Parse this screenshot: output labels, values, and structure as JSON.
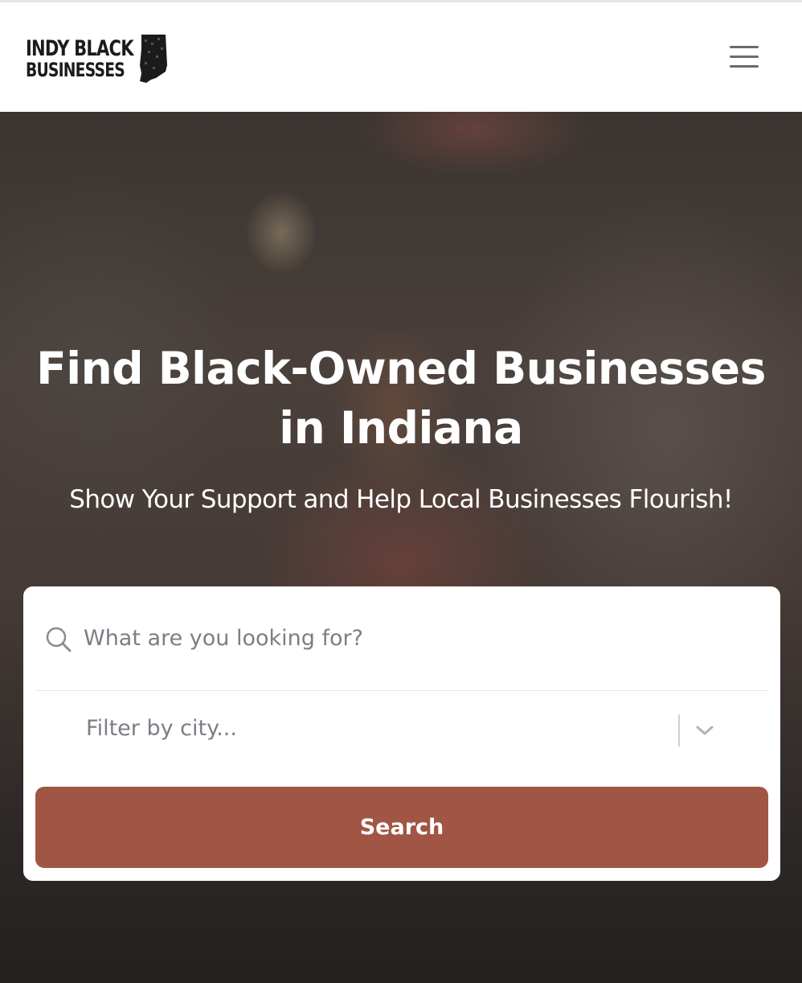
{
  "header": {
    "logo_line1": "INDY BLACK",
    "logo_line2": "BUSINESSES",
    "menu_icon": "hamburger-menu-icon"
  },
  "hero": {
    "title": "Find Black-Owned Businesses in Indiana",
    "subtitle": "Show Your Support and Help Local Businesses Flourish!"
  },
  "search": {
    "icon": "search-icon",
    "placeholder": "What are you looking for?",
    "city_placeholder": "Filter by city...",
    "city_dropdown_icon": "chevron-down-icon",
    "button_label": "Search"
  },
  "colors": {
    "accent": "#a05545",
    "placeholder_text": "#7d7d86",
    "header_bg": "#ffffff"
  }
}
